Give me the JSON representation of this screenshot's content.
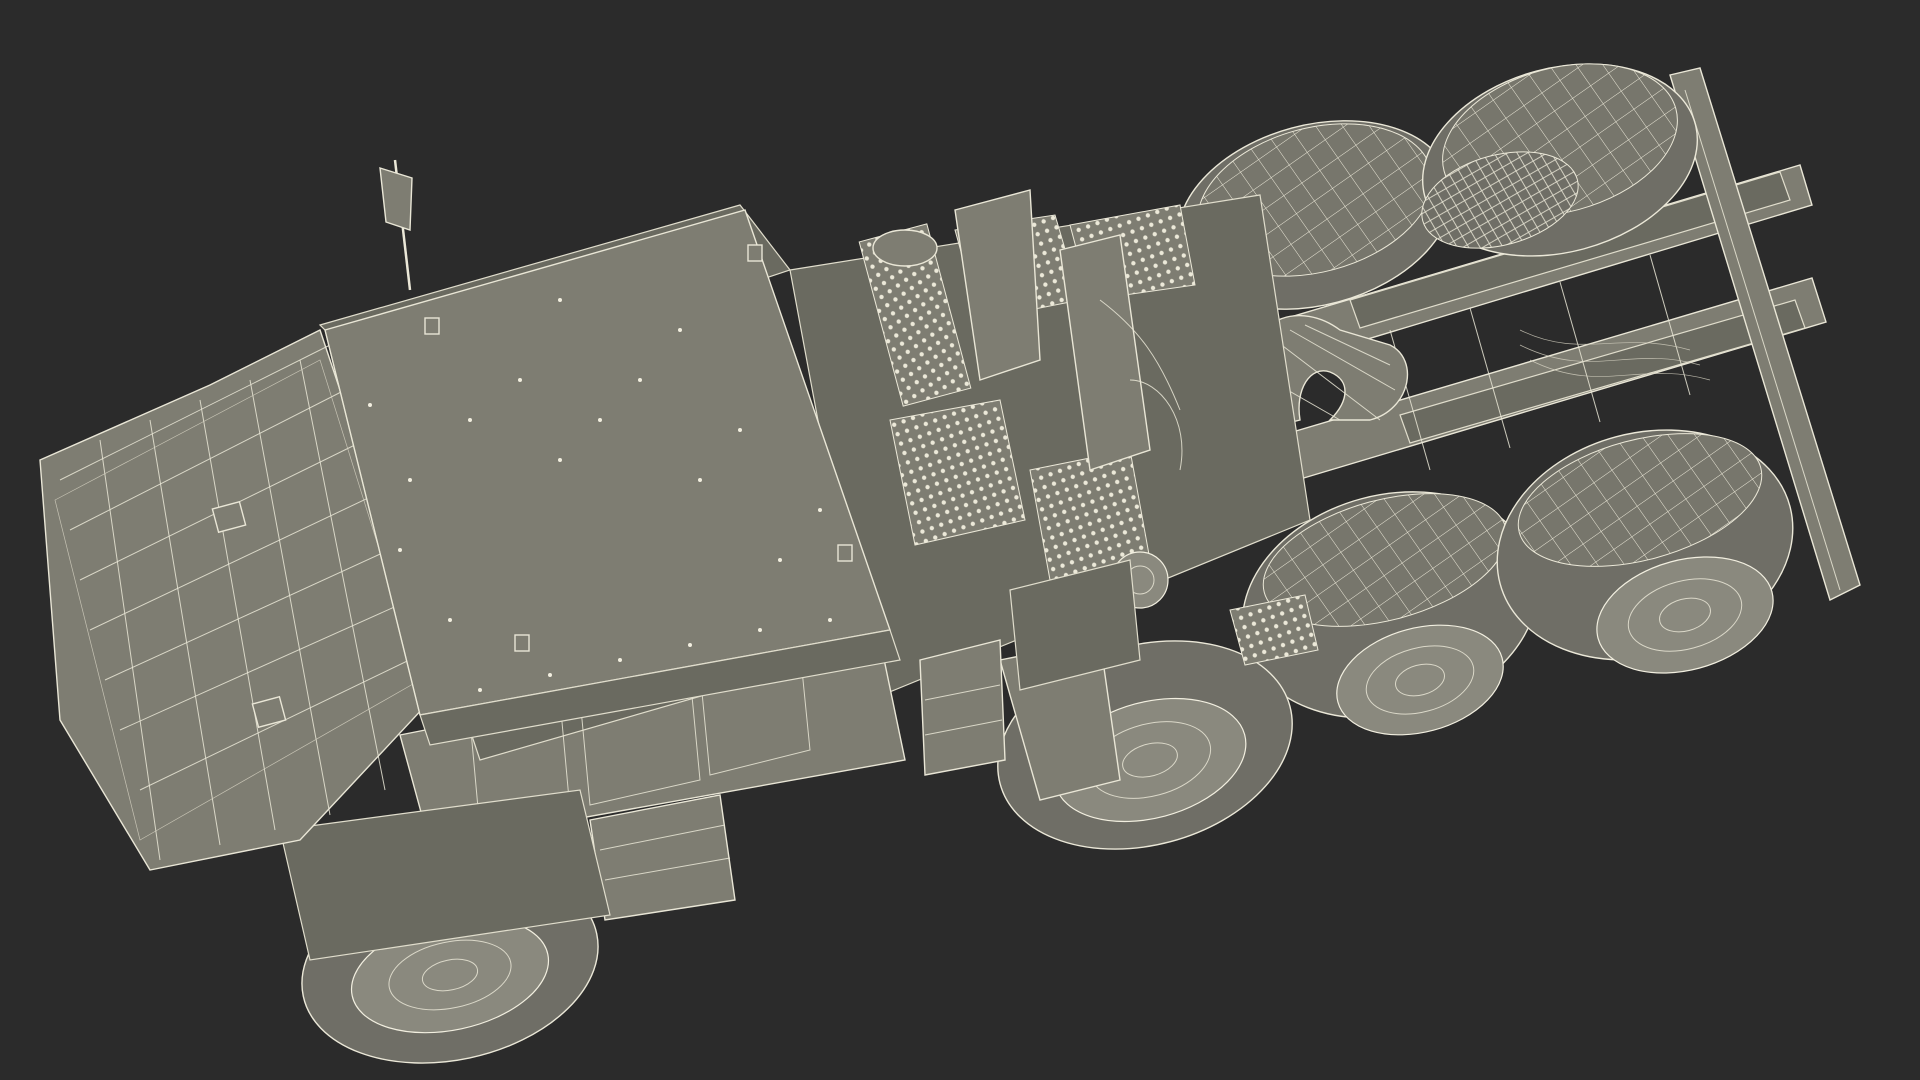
{
  "scene": {
    "background": "#2b2b2b",
    "model_color": "#7e7d72",
    "wire_color": "#e9e6d6"
  }
}
